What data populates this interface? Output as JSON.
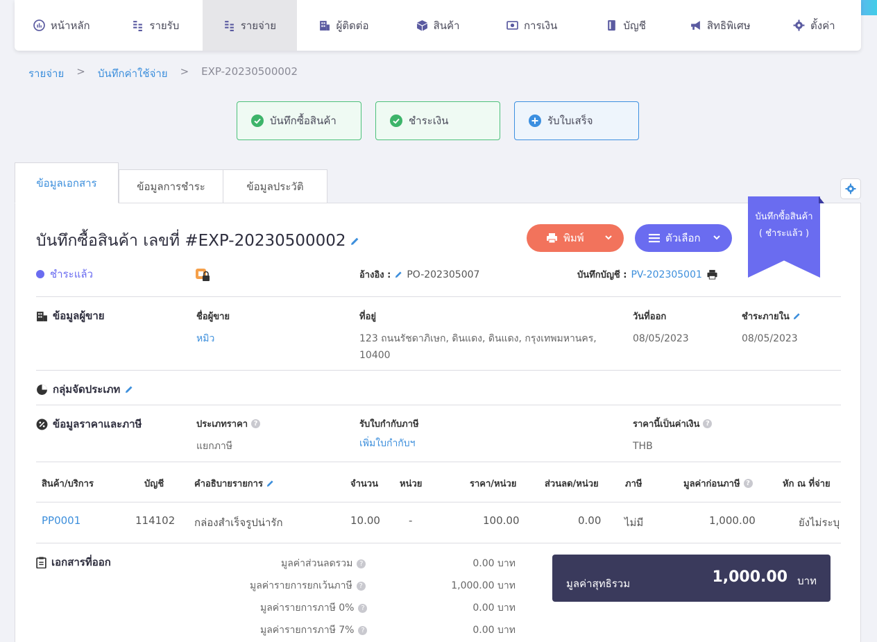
{
  "nav": {
    "items": [
      {
        "label": "หน้าหลัก",
        "icon": "dashboard-icon"
      },
      {
        "label": "รายรับ",
        "icon": "coins-icon"
      },
      {
        "label": "รายจ่าย",
        "icon": "coins-icon"
      },
      {
        "label": "ผู้ติดต่อ",
        "icon": "building-icon"
      },
      {
        "label": "สินค้า",
        "icon": "box-icon"
      },
      {
        "label": "การเงิน",
        "icon": "money-icon"
      },
      {
        "label": "บัญชี",
        "icon": "book-icon"
      },
      {
        "label": "สิทธิพิเศษ",
        "icon": "megaphone-icon"
      },
      {
        "label": "ตั้งค่า",
        "icon": "gear-icon"
      }
    ],
    "active_index": 2
  },
  "breadcrumb": {
    "items": [
      "รายจ่าย",
      "บันทึกค่าใช้จ่าย",
      "EXP-20230500002"
    ],
    "separator": ">"
  },
  "steps": [
    {
      "label": "บันทึกซื้อสินค้า",
      "state": "done"
    },
    {
      "label": "ชำระเงิน",
      "state": "done"
    },
    {
      "label": "รับใบเสร็จ",
      "state": "todo"
    }
  ],
  "tabs": [
    "ข้อมูลเอกสาร",
    "ข้อมูลการชำระ",
    "ข้อมูลประวัติ"
  ],
  "doc": {
    "title": "บันทึกซื้อสินค้า เลขที่ #EXP-20230500002",
    "print_label": "พิมพ์",
    "options_label": "ตัวเลือก",
    "ribbon_line1": "บันทึกซื้อสินค้า",
    "ribbon_line2": "( ชำระแล้ว )",
    "status": "ชำระแล้ว",
    "ref_label": "อ้างอิง :",
    "ref_value": "PO-202305007",
    "acct_label": "บันทึกบัญชี :",
    "acct_value": "PV-202305001"
  },
  "vendor": {
    "section": "ข้อมูลผู้ขาย",
    "name_label": "ชื่อผู้ขาย",
    "name": "หมิว",
    "address_label": "ที่อยู่",
    "address_line1": "123 ถนนรัชดาภิเษก, ดินแดง, ดินแดง, กรุงเทพมหานคร,",
    "address_line2": "10400",
    "issue_label": "วันที่ออก",
    "issue_date": "08/05/2023",
    "due_label": "ชำระภายใน",
    "due_date": "08/05/2023"
  },
  "category": {
    "section": "กลุ่มจัดประเภท"
  },
  "pricing": {
    "section": "ข้อมูลราคาและภาษี",
    "price_type_label": "ประเภทราคา",
    "price_type": "แยกภาษี",
    "tax_receipt_label": "รับใบกำกับภาษี",
    "tax_receipt_action": "เพิ่มใบกำกับฯ",
    "currency_label": "ราคานี้เป็นค่าเงิน",
    "currency": "THB"
  },
  "table": {
    "headers": [
      "สินค้า/บริการ",
      "บัญชี",
      "คำอธิบายรายการ",
      "จำนวน",
      "หน่วย",
      "ราคา/หน่วย",
      "ส่วนลด/หน่วย",
      "ภาษี",
      "มูลค่าก่อนภาษี",
      "หัก ณ ที่จ่าย"
    ],
    "rows": [
      [
        "PP0001",
        "114102",
        "กล่องสำเร็จรูปน่ารัก",
        "10.00",
        "-",
        "100.00",
        "0.00",
        "ไม่มี",
        "1,000.00",
        "ยังไม่ระบุ"
      ]
    ]
  },
  "docs_section": "เอกสารที่ออก",
  "summary": [
    {
      "label": "มูลค่าส่วนลดรวม",
      "value": "0.00 บาท"
    },
    {
      "label": "มูลค่ารายการยกเว้นภาษี",
      "value": "1,000.00 บาท"
    },
    {
      "label": "มูลค่ารายการภาษี 0%",
      "value": "0.00 บาท"
    },
    {
      "label": "มูลค่ารายการภาษี 7%",
      "value": "0.00 บาท"
    }
  ],
  "total": {
    "label": "มูลค่าสุทธิรวม",
    "value": "1,000.00",
    "unit": "บาท"
  },
  "colors": {
    "accent": "#6a6cf0",
    "print": "#f2735c",
    "link": "#3d8fdc",
    "done": "#4cc07a",
    "total_bg": "#3a3a5c"
  }
}
